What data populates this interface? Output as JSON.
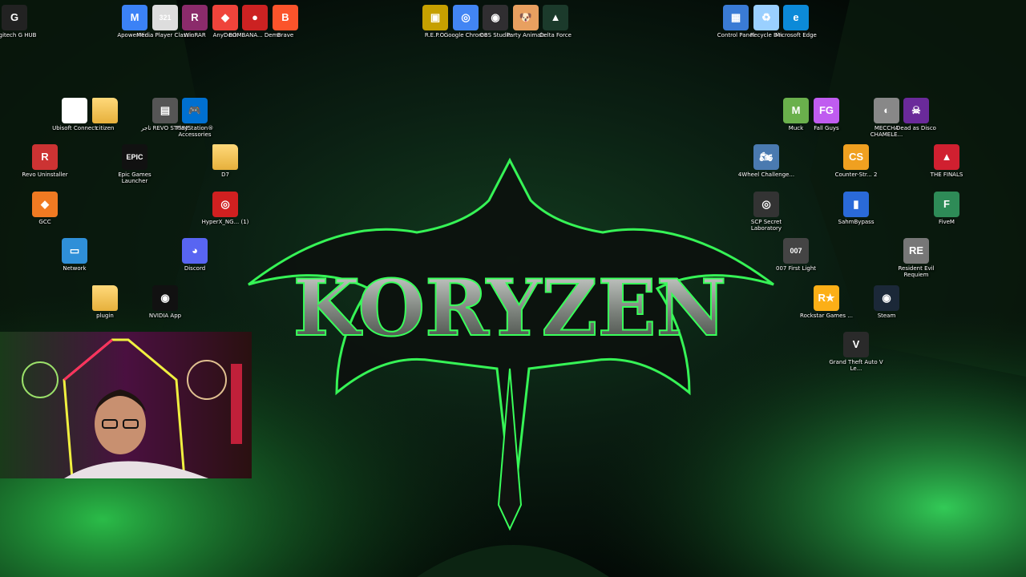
{
  "wallpaper": {
    "brand": "KORYZEN",
    "accent_color": "#39ff5a"
  },
  "desktop_icons": [
    {
      "id": "logitech",
      "label": "Logitech G HUB",
      "icon": "logitech-g-icon",
      "color": "#222222",
      "glyph": "G"
    },
    {
      "id": "apowermirror",
      "label": "ApowerMir...",
      "icon": "apowermirror-icon",
      "color": "#3b82f6",
      "glyph": "M"
    },
    {
      "id": "mpc",
      "label": "Media Player Classic",
      "icon": "media-player-icon",
      "color": "#dddddd",
      "glyph": "321"
    },
    {
      "id": "winrar",
      "label": "WinRAR",
      "icon": "winrar-icon",
      "color": "#8b2b6b",
      "glyph": "R"
    },
    {
      "id": "anydesk",
      "label": "AnyDesk",
      "icon": "anydesk-icon",
      "color": "#ef443b",
      "glyph": "◆"
    },
    {
      "id": "bombana",
      "label": "BOMBANA... Demo",
      "icon": "bombana-icon",
      "color": "#cc2222",
      "glyph": "●"
    },
    {
      "id": "brave",
      "label": "Brave",
      "icon": "brave-icon",
      "color": "#fb542b",
      "glyph": "B"
    },
    {
      "id": "repo",
      "label": "R.E.P.O.",
      "icon": "repo-icon",
      "color": "#c6a000",
      "glyph": "▣"
    },
    {
      "id": "chrome",
      "label": "Google Chrome",
      "icon": "chrome-icon",
      "color": "#4285f4",
      "glyph": "◎"
    },
    {
      "id": "obs",
      "label": "OBS Studio",
      "icon": "obs-icon",
      "color": "#302e31",
      "glyph": "◉"
    },
    {
      "id": "party",
      "label": "Party Animals",
      "icon": "party-animals-icon",
      "color": "#e8a060",
      "glyph": "🐶"
    },
    {
      "id": "delta",
      "label": "Delta Force",
      "icon": "delta-force-icon",
      "color": "#1b3a2b",
      "glyph": "▲"
    },
    {
      "id": "control",
      "label": "Control Panel",
      "icon": "control-panel-icon",
      "color": "#3a7bd5",
      "glyph": "▦"
    },
    {
      "id": "recycle",
      "label": "Recycle Bin",
      "icon": "recycle-bin-icon",
      "color": "#9ad0ff",
      "glyph": "♻"
    },
    {
      "id": "edge",
      "label": "Microsoft Edge",
      "icon": "edge-icon",
      "color": "#0c8ad8",
      "glyph": "e"
    },
    {
      "id": "ubisoft",
      "label": "Ubisoft Connect",
      "icon": "ubisoft-icon",
      "color": "#ffffff",
      "glyph": "◍"
    },
    {
      "id": "citizen",
      "label": "citizen",
      "icon": "folder-icon",
      "color": "#e6b03c",
      "glyph": ""
    },
    {
      "id": "revostore",
      "label": "تاجر REVO STORE",
      "icon": "revo-store-icon",
      "color": "#555555",
      "glyph": "▤"
    },
    {
      "id": "ps",
      "label": "PlayStation® Accessories",
      "icon": "playstation-icon",
      "color": "#0070d1",
      "glyph": "🎮"
    },
    {
      "id": "revo",
      "label": "Revo Uninstaller",
      "icon": "revo-uninstaller-icon",
      "color": "#cc3333",
      "glyph": "R"
    },
    {
      "id": "epic",
      "label": "Epic Games Launcher",
      "icon": "epic-games-icon",
      "color": "#111111",
      "glyph": "EPIC"
    },
    {
      "id": "d7",
      "label": "D7",
      "icon": "folder-icon",
      "color": "#e6b03c",
      "glyph": ""
    },
    {
      "id": "gcc",
      "label": "GCC",
      "icon": "gcc-icon",
      "color": "#f07a22",
      "glyph": "◆"
    },
    {
      "id": "hyperx",
      "label": "HyperX_NG... (1)",
      "icon": "hyperx-icon",
      "color": "#d02020",
      "glyph": "◎"
    },
    {
      "id": "network",
      "label": "Network",
      "icon": "network-icon",
      "color": "#2f8fd8",
      "glyph": "▭"
    },
    {
      "id": "discord",
      "label": "Discord",
      "icon": "discord-icon",
      "color": "#5865f2",
      "glyph": "◕"
    },
    {
      "id": "plugin",
      "label": "plugin",
      "icon": "folder-icon",
      "color": "#e6b03c",
      "glyph": ""
    },
    {
      "id": "nvidia",
      "label": "NVIDIA App",
      "icon": "nvidia-icon",
      "color": "#111111",
      "glyph": "◉"
    },
    {
      "id": "muck",
      "label": "Muck",
      "icon": "muck-icon",
      "color": "#6ab04c",
      "glyph": "M"
    },
    {
      "id": "fallguys",
      "label": "Fall Guys",
      "icon": "fall-guys-icon",
      "color": "#c05cf0",
      "glyph": "FG"
    },
    {
      "id": "meccha",
      "label": "MECCHA CHAMELE...",
      "icon": "meccha-icon",
      "color": "#888888",
      "glyph": "◐"
    },
    {
      "id": "deadas",
      "label": "Dead as Disco",
      "icon": "dead-as-disco-icon",
      "color": "#6a2a9a",
      "glyph": "☠"
    },
    {
      "id": "4wheel",
      "label": "4Wheel Challenge...",
      "icon": "4wheel-icon",
      "color": "#4a7ab0",
      "glyph": "🏍"
    },
    {
      "id": "cs",
      "label": "Counter-Str... 2",
      "icon": "counter-strike-icon",
      "color": "#f0a020",
      "glyph": "CS"
    },
    {
      "id": "finals",
      "label": "THE FINALS",
      "icon": "the-finals-icon",
      "color": "#d02030",
      "glyph": "▲"
    },
    {
      "id": "scp",
      "label": "SCP Secret Laboratory",
      "icon": "scp-icon",
      "color": "#333333",
      "glyph": "◎"
    },
    {
      "id": "sahm",
      "label": "SahmBypass",
      "icon": "sahmbypass-icon",
      "color": "#2a6ad8",
      "glyph": "▮"
    },
    {
      "id": "fivem",
      "label": "FiveM",
      "icon": "fivem-icon",
      "color": "#2e8b57",
      "glyph": "F"
    },
    {
      "id": "007",
      "label": "007 First Light",
      "icon": "007-icon",
      "color": "#444444",
      "glyph": "007"
    },
    {
      "id": "re",
      "label": "Resident Evil Requiem",
      "icon": "resident-evil-icon",
      "color": "#777777",
      "glyph": "RE"
    },
    {
      "id": "rockstar",
      "label": "Rockstar Games ...",
      "icon": "rockstar-icon",
      "color": "#fcaf17",
      "glyph": "R★"
    },
    {
      "id": "steam",
      "label": "Steam",
      "icon": "steam-icon",
      "color": "#1b2838",
      "glyph": "◉"
    },
    {
      "id": "gta",
      "label": "Grand Theft Auto V Le...",
      "icon": "gta-icon",
      "color": "#2a2a2a",
      "glyph": "V"
    }
  ]
}
